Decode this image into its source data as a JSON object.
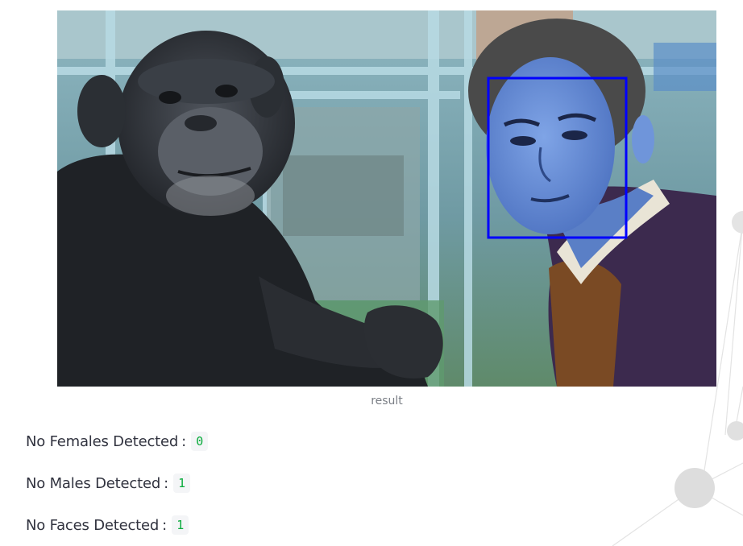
{
  "result_image": {
    "caption": "result",
    "detection_box_color": "#0000ff",
    "subjects": [
      "chimpanzee",
      "man"
    ]
  },
  "stats": [
    {
      "label": "No Females Detected",
      "separator": ":",
      "value": "0"
    },
    {
      "label": "No Males Detected",
      "separator": ":",
      "value": "1"
    },
    {
      "label": "No Faces Detected",
      "separator": ":",
      "value": "1"
    }
  ],
  "theme": {
    "value_color": "#09ab3b",
    "value_bg": "#f4f5f7",
    "text_color": "#31333f"
  }
}
